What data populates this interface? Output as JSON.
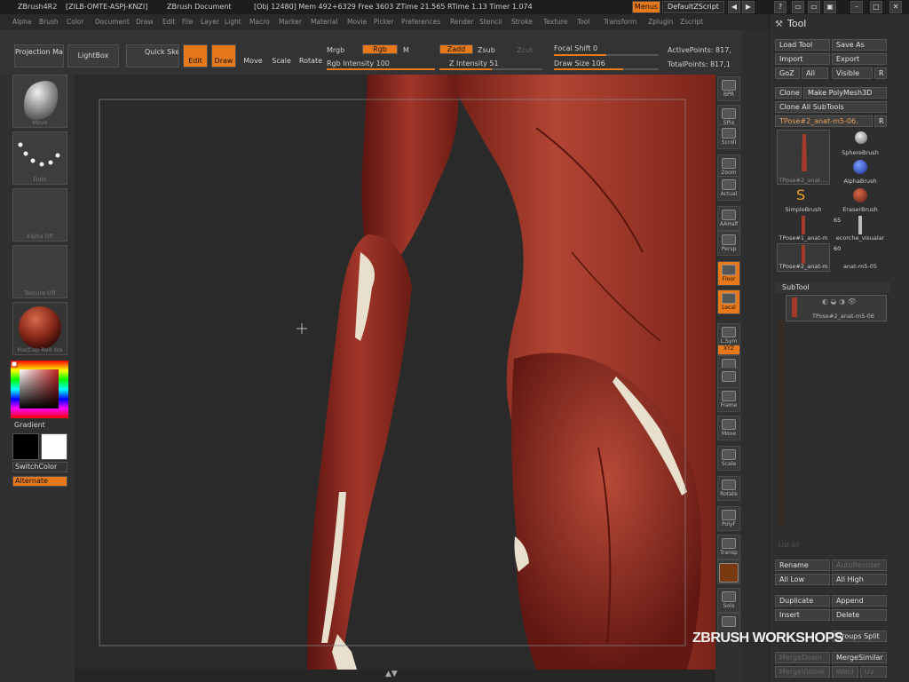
{
  "title": {
    "app": "ZBrush4R2",
    "serial": "[ZILB-OMTE-ASPJ-KNZI]",
    "doc": "ZBrush Document",
    "stats": "[Obj 12480] Mem 492+6329 Free 3603 ZTime 21.565 RTime 1.13 Timer 1.074",
    "menus_btn": "Menus",
    "zscript": "DefaultZScript"
  },
  "menus": [
    "Alpha",
    "Brush",
    "Color",
    "Document",
    "Draw",
    "Edit",
    "File",
    "Layer",
    "Light",
    "Macro",
    "Marker",
    "Material",
    "Movie",
    "Picker",
    "Preferences",
    "Render",
    "Stencil",
    "Stroke",
    "Texture",
    "Tool",
    "Transform",
    "Zplugin",
    "Zscript"
  ],
  "shelf": {
    "projection_master": "Projection Master",
    "lightbox": "LightBox",
    "quick_sketch": "Quick Sketch",
    "edit": "Edit",
    "draw": "Draw",
    "move": "Move",
    "scale": "Scale",
    "rotate": "Rotate",
    "move_key": "M",
    "scale_key": "S",
    "rotate_key": "R",
    "mrgb": "Mrgb",
    "rgb": "Rgb",
    "m": "M",
    "rgb_intensity": "Rgb Intensity 100",
    "zadd": "Zadd",
    "zsub": "Zsub",
    "zcut": "Zcut",
    "z_intensity": "Z Intensity 51",
    "z_intensity_value": 0.51,
    "focal_shift": "Focal Shift 0",
    "draw_size": "Draw Size 106",
    "active_points": "ActivePoints: 817,",
    "total_points": "TotalPoints: 817,1"
  },
  "left": {
    "brush_cap": "Move",
    "stroke_cap": "Dots",
    "alpha_cap": "Alpha Off",
    "texture_cap": "Texture Off",
    "material_cap": "MatCap Red Wa",
    "gradient": "Gradient",
    "switch_color": "SwitchColor",
    "alternate": "Alternate"
  },
  "right": [
    "BPR",
    "SPix",
    "Scroll",
    "Zoom",
    "Actual",
    "AAHalf",
    "Persp",
    "Floor",
    "Local",
    "L.Sym",
    "XYZ",
    "",
    "",
    "Frame",
    "Move",
    "Scale",
    "Rotate",
    "PolyF",
    "Transp",
    "",
    "Solo",
    ""
  ],
  "tool": {
    "title": "Tool",
    "load": "Load Tool",
    "save": "Save As",
    "import": "Import",
    "export": "Export",
    "goz": "GoZ",
    "all": "All",
    "visible": "Visible",
    "r": "R",
    "clone": "Clone",
    "make_polymesh": "Make PolyMesh3D",
    "clone_all": "Clone All SubTools",
    "current": "TPose#2_anat-m5-06.",
    "thumbs": [
      {
        "cap": "TPose#2_anat-..."
      },
      {
        "cap": "SphereBrush"
      },
      {
        "cap": "AlphaBrush"
      },
      {
        "cap": "SimpleBrush"
      },
      {
        "cap": "EraserBrush"
      },
      {
        "cap": "TPose#1_anat-m"
      },
      {
        "cap": "ecorche_visualar"
      },
      {
        "cap": "TPose#2_anat-m"
      },
      {
        "cap": "anat-m5-05"
      }
    ],
    "count65": "65",
    "count60": "60",
    "subtool": "SubTool",
    "subtool_item": "TPose#2_anat-m5-06",
    "rename": "Rename",
    "autoreorder": "AutoReorder",
    "all_low": "All Low",
    "all_high": "All High",
    "duplicate": "Duplicate",
    "append": "Append",
    "insert": "Insert",
    "delete": "Delete",
    "groups_split": "Groups Split",
    "merge_down": "MergeDown",
    "merge_similar": "MergeSimilar",
    "merge_visible": "MergeVisible",
    "weld": "Weld",
    "uv": "Uv",
    "list_all": "List All"
  },
  "watermark": "ZBRUSH WORKSHOPS"
}
